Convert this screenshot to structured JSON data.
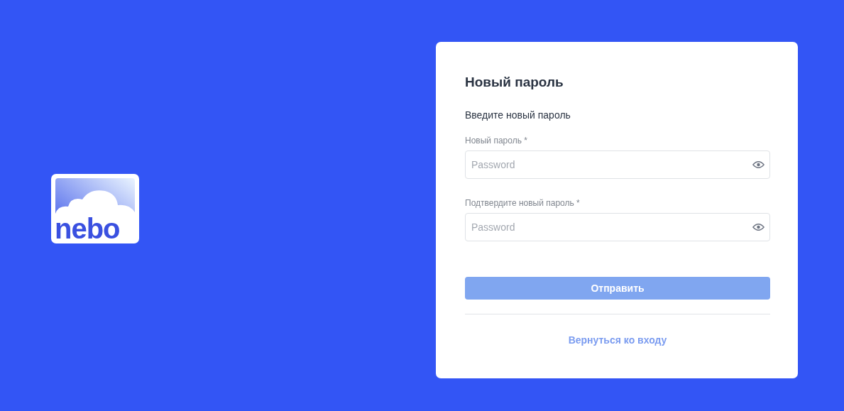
{
  "logo": {
    "text": "nebo"
  },
  "card": {
    "title": "Новый пароль",
    "subtitle": "Введите новый пароль",
    "fields": [
      {
        "label": "Новый пароль *",
        "placeholder": "Password"
      },
      {
        "label": "Подтвердите новый пароль *",
        "placeholder": "Password"
      }
    ],
    "submit": {
      "label": "Отправить",
      "disabled": true
    },
    "back_link": "Вернуться ко входу"
  }
}
